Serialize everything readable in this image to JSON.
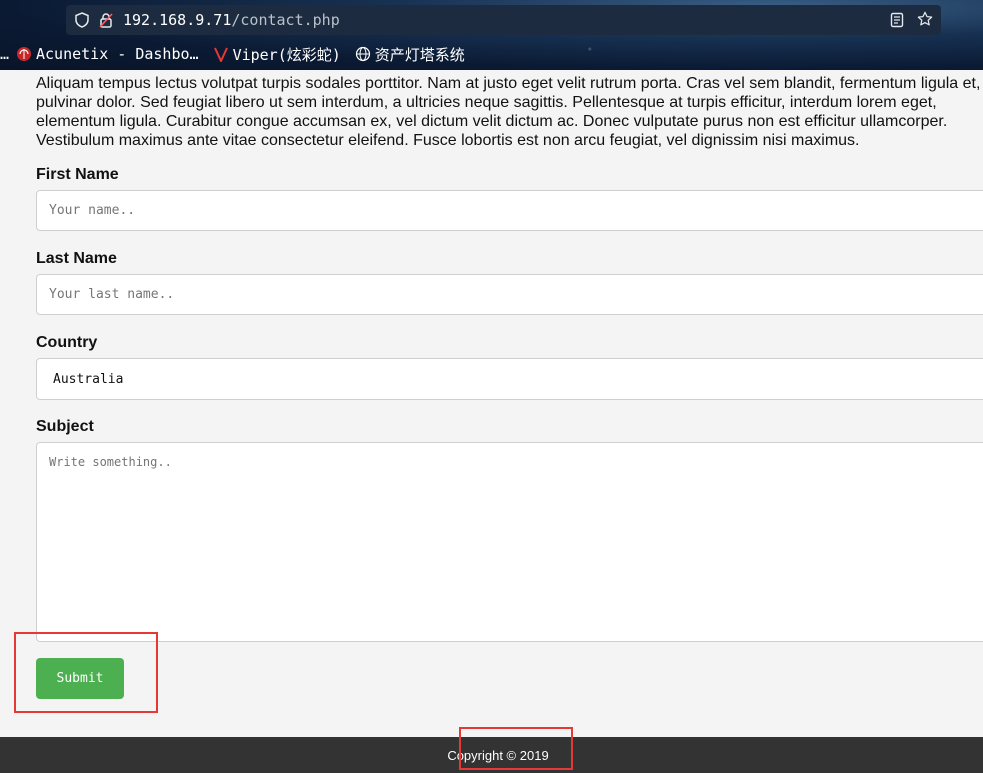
{
  "browser": {
    "url_host": "192.168.9.71",
    "url_path": "/contact.php",
    "bookmarks": [
      {
        "label": "Acunetix - Dashbo…",
        "icon": "acunetix-icon"
      },
      {
        "label": "Viper(炫彩蛇)",
        "icon": "viper-icon"
      },
      {
        "label": "资产灯塔系统",
        "icon": "globe-icon"
      }
    ],
    "overflow_label": "…"
  },
  "page": {
    "intro": "Aliquam tempus lectus volutpat turpis sodales porttitor. Nam at justo eget velit rutrum porta. Cras vel sem blandit, fermentum ligula et, pulvinar dolor. Sed feugiat libero ut sem interdum, a ultricies neque sagittis. Pellentesque at turpis efficitur, interdum lorem eget, elementum ligula. Curabitur congue accumsan ex, vel dictum velit dictum ac. Donec vulputate purus non est efficitur ullamcorper. Vestibulum maximus ante vitae consectetur eleifend. Fusce lobortis est non arcu feugiat, vel dignissim nisi maximus."
  },
  "form": {
    "first_name": {
      "label": "First Name",
      "placeholder": "Your name..",
      "value": ""
    },
    "last_name": {
      "label": "Last Name",
      "placeholder": "Your last name..",
      "value": ""
    },
    "country": {
      "label": "Country",
      "value": "Australia"
    },
    "subject": {
      "label": "Subject",
      "placeholder": "Write something..",
      "value": ""
    },
    "submit_label": "Submit"
  },
  "footer": {
    "copyright": "Copyright © 2019"
  },
  "colors": {
    "submit": "#4caf50",
    "footer": "#333333",
    "annotation": "#e53935"
  }
}
